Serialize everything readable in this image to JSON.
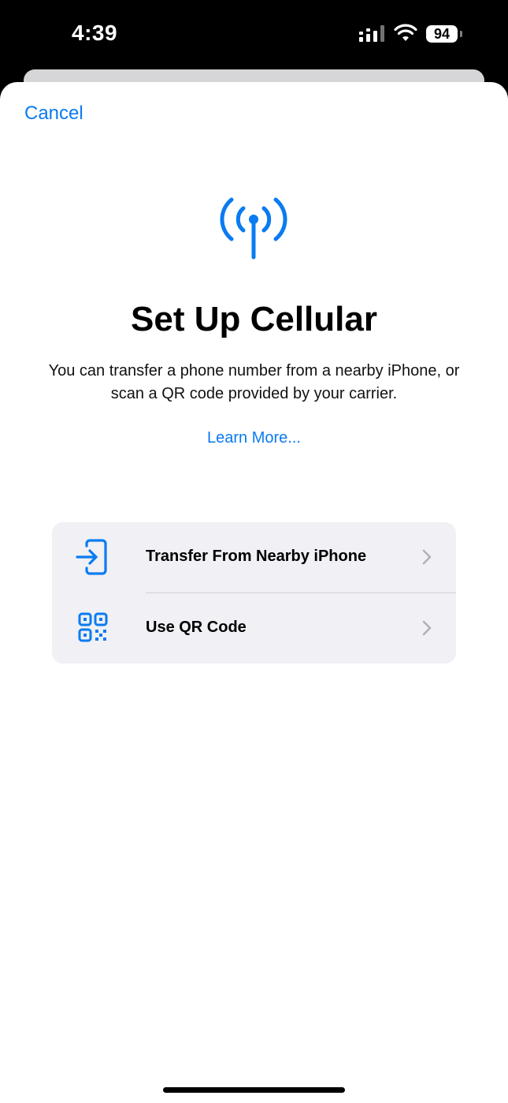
{
  "status_bar": {
    "time": "4:39",
    "battery_level": "94",
    "signal_icon": "cellular-signal-icon",
    "wifi_icon": "wifi-icon"
  },
  "sheet": {
    "cancel_label": "Cancel",
    "hero_icon": "antenna-radiowaves-icon",
    "title": "Set Up Cellular",
    "subtitle": "You can transfer a phone number from a nearby iPhone, or scan a QR code provided by your carrier.",
    "learn_more_label": "Learn More...",
    "options": [
      {
        "label": "Transfer From Nearby iPhone",
        "icon": "transfer-arrow-icon"
      },
      {
        "label": "Use QR Code",
        "icon": "qr-code-icon"
      }
    ]
  },
  "colors": {
    "accent": "#0a7bf0",
    "card_background": "#f0f0f5",
    "sheet_background": "#ffffff",
    "status_bar_background": "#000000"
  }
}
